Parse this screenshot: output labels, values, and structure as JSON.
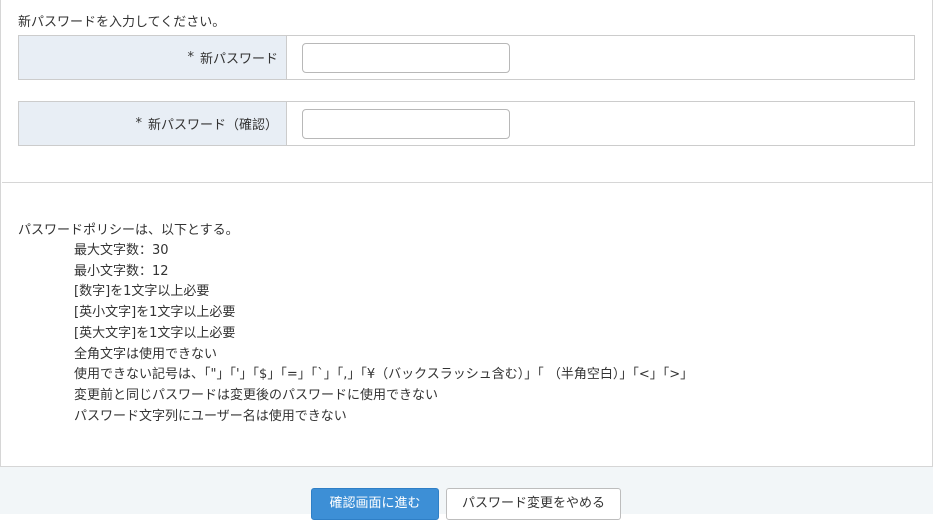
{
  "form": {
    "intro": "新パスワードを入力してください。",
    "rows": [
      {
        "required_mark": "*",
        "label": "新パスワード",
        "value": "",
        "placeholder": ""
      },
      {
        "required_mark": "*",
        "label": "新パスワード（確認）",
        "value": "",
        "placeholder": ""
      }
    ]
  },
  "policy": {
    "heading": "パスワードポリシーは、以下とする。",
    "items": [
      "最大文字数：30",
      "最小文字数：12",
      "[数字]を1文字以上必要",
      "[英小文字]を1文字以上必要",
      "[英大文字]を1文字以上必要",
      "全角文字は使用できない",
      "使用できない記号は、「\"」「'」「$」「=」「`」「,」「¥（バックスラッシュ含む）」「 （半角空白）」「<」「>」",
      "変更前と同じパスワードは変更後のパスワードに使用できない",
      "パスワード文字列にユーザー名は使用できない"
    ]
  },
  "footer": {
    "confirm_label": "確認画面に進む",
    "cancel_label": "パスワード変更をやめる"
  },
  "colors": {
    "label_background": "#e8eef5",
    "primary_button": "#3d8fd6",
    "footer_background": "#f2f6f8",
    "border": "#cccccc"
  }
}
